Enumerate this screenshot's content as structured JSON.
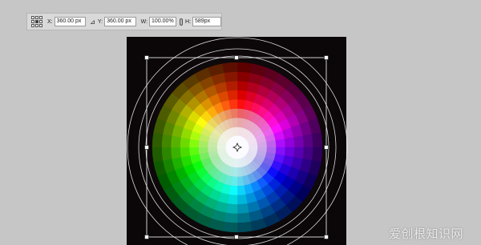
{
  "options_bar": {
    "x_label": "X:",
    "x_value": "360.00 px",
    "y_label": "Y:",
    "y_value": "360.00 px",
    "w_label": "W:",
    "w_value": "100.00%",
    "h_label": "H:",
    "h_value": "589px",
    "reference_point_icon": "reference-point-grid-icon",
    "delta_icon": "delta-icon",
    "link_icon": "link-icon"
  },
  "canvas": {
    "color_wheel": {
      "rings": 8,
      "sectors": 36,
      "background": "#0b0708"
    }
  },
  "transform": {
    "handle_color": "#ffffff",
    "guide_color": "#ffffff"
  },
  "watermark": "爱创根知识网"
}
